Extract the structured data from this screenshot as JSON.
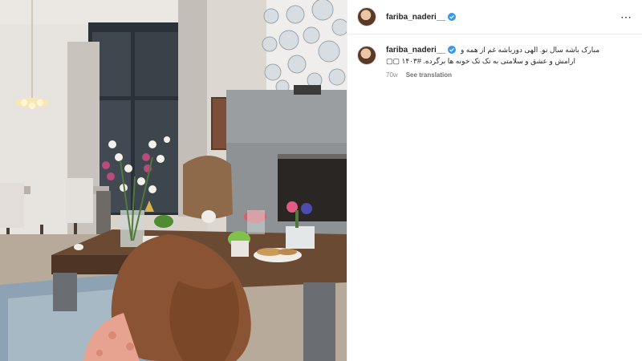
{
  "post": {
    "username": "fariba_naderi__",
    "caption_line1": "مبارک باشه سال نو. الهی دورباشه غم از همه و",
    "caption_line2": "ارامش و عشق و سلامتی به تک تک خونه ها برگرده. #۱۴۰۳ ▢▢",
    "time_ago": "70w",
    "see_translation": "See translation",
    "more_icon": "⋯"
  },
  "colors": {
    "verified": "#3897f0",
    "text": "#262626",
    "muted": "#8e8e8e"
  }
}
